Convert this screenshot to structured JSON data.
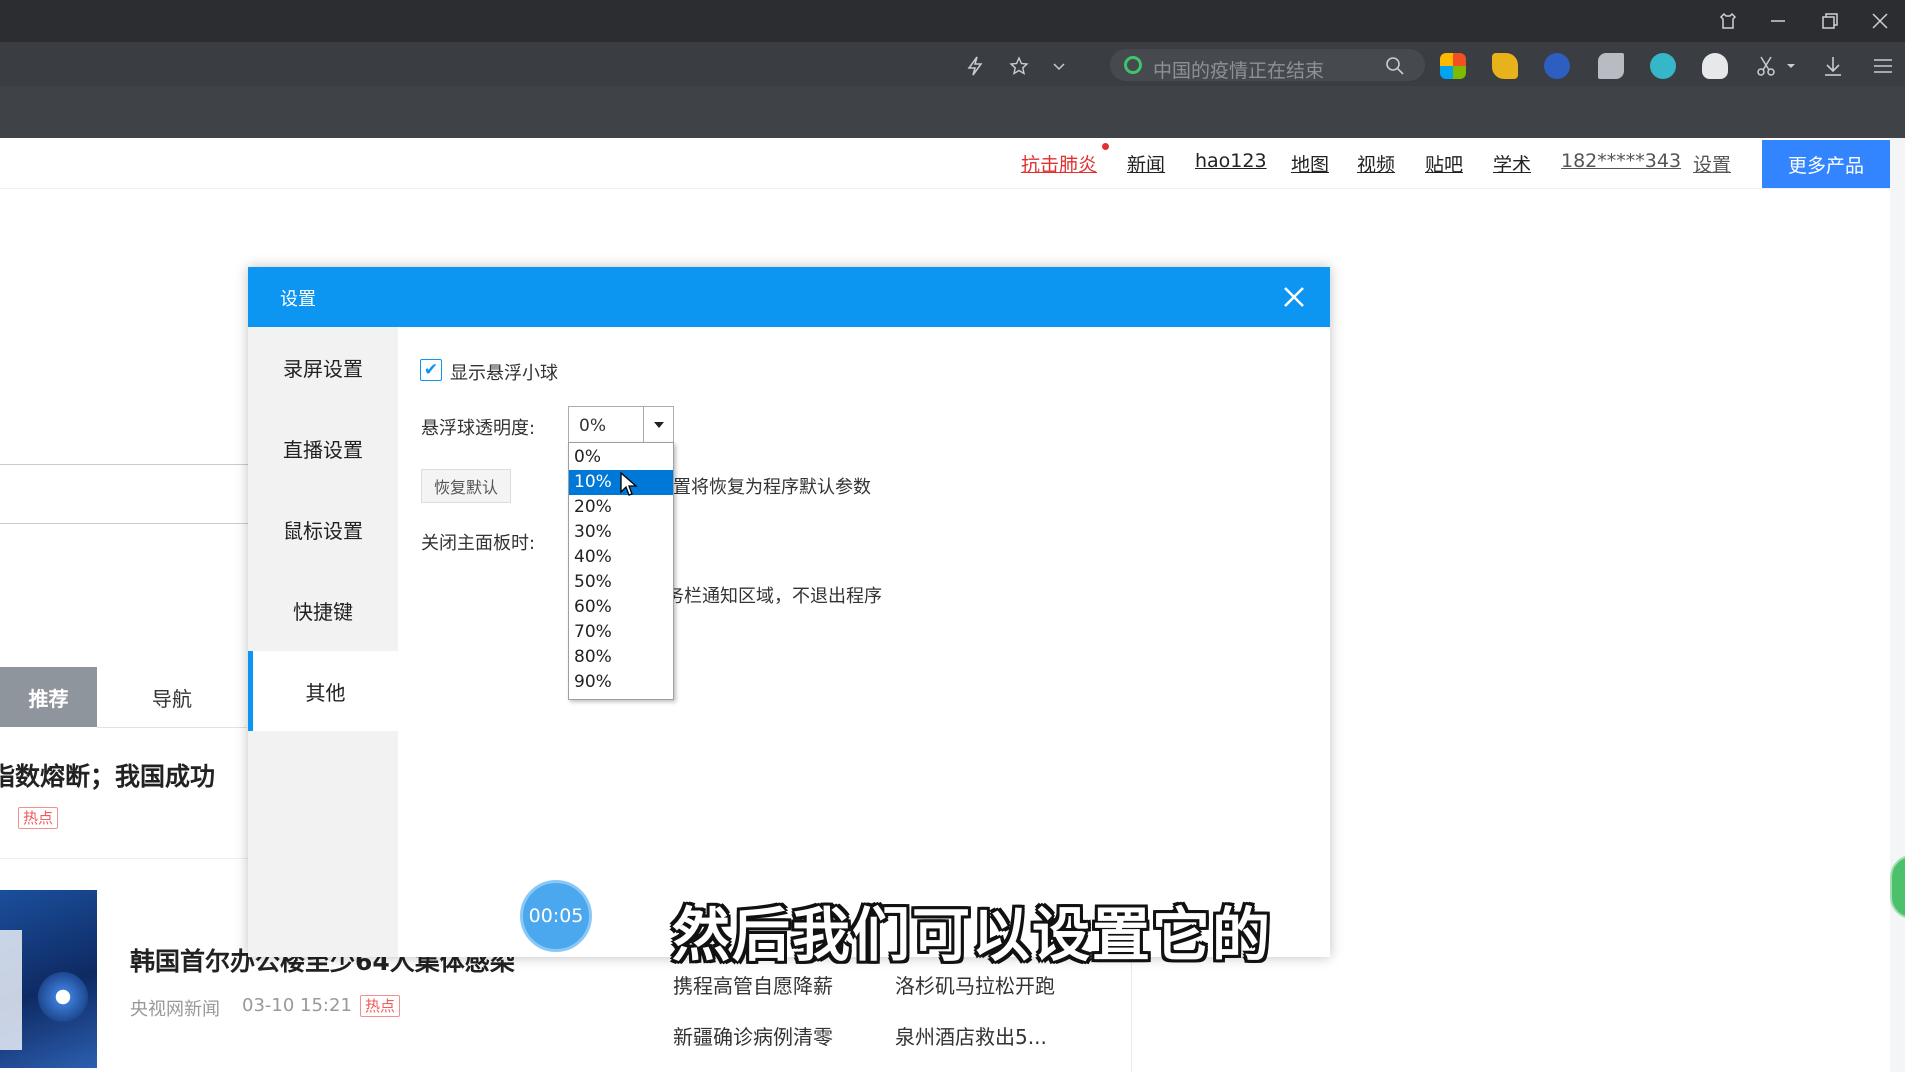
{
  "browser": {
    "search_placeholder": "中国的疫情正在结束"
  },
  "topnav": {
    "items": [
      "抗击肺炎",
      "新闻",
      "hao123",
      "地图",
      "视频",
      "贴吧",
      "学术",
      "182*****343",
      "设置"
    ],
    "more_products": "更多产品",
    "highlight_color": "#e03030"
  },
  "page": {
    "tabs": {
      "recommend": "推荐",
      "nav": "导航"
    },
    "headline_partial": "指数熔断；我国成功",
    "hot_tag": "热点",
    "news_title": "韩国首尔办公楼至少64人集体感染",
    "news_source": "央视网新闻",
    "news_time": "03-10 15:21",
    "side_links": [
      "携程高管自愿降薪",
      "洛杉矶马拉松开跑",
      "新疆确诊病例清零",
      "泉州酒店救出5..."
    ]
  },
  "dialog": {
    "title": "设置",
    "sidebar": [
      "录屏设置",
      "直播设置",
      "鼠标设置",
      "快捷键",
      "其他"
    ],
    "active_index": 4,
    "show_ball_label": "显示悬浮小球",
    "show_ball_checked": true,
    "opacity_label": "悬浮球透明度:",
    "opacity_value": "0%",
    "opacity_options": [
      "0%",
      "10%",
      "20%",
      "30%",
      "40%",
      "50%",
      "60%",
      "70%",
      "80%",
      "90%"
    ],
    "opacity_highlighted": "10%",
    "restore_button": "恢复默认",
    "restore_hint_partial": "置将恢复为程序默认参数",
    "close_panel_label": "关闭主面板时:",
    "close_panel_hint_partial": "务栏通知区域，不退出程序",
    "accent_color": "#0d95f2"
  },
  "overlay": {
    "timer": "00:05",
    "subtitle": "然后我们可以设置它的"
  }
}
